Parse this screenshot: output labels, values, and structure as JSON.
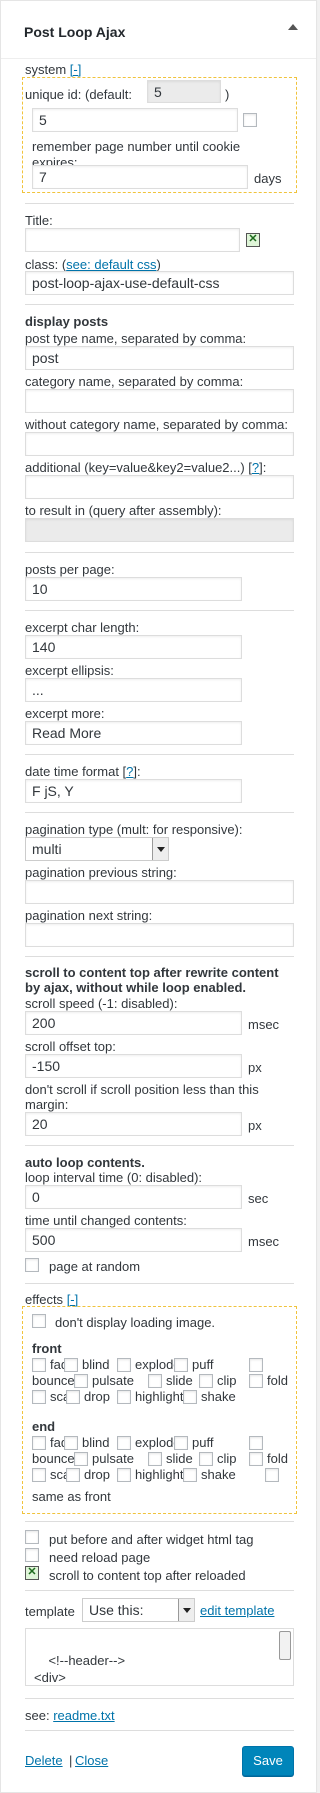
{
  "widget": {
    "title": "Post Loop Ajax"
  },
  "system": {
    "label": "system",
    "toggle": "[-]",
    "unique_id_prefix": "unique id: (default:",
    "unique_id_default": "5",
    "unique_id_suffix": ")",
    "unique_id_value": "5",
    "remember_line1": "remember page number until cookie",
    "remember_line2": "expires:",
    "days_value": "7",
    "days_unit": "days"
  },
  "title_field": {
    "label": "Title:",
    "value": ""
  },
  "class_field": {
    "prefix": "class: (",
    "link": "see: default css",
    "suffix": ")",
    "value": "post-loop-ajax-use-default-css"
  },
  "display_posts": {
    "heading": "display posts",
    "post_type_label": "post type name, separated by comma:",
    "post_type_value": "post",
    "category_label": "category name, separated by comma:",
    "category_value": "",
    "without_category_label": "without category name, separated by comma:",
    "without_category_value": "",
    "additional_label": "additional (key=value&key2=value2...) [",
    "additional_help": "?",
    "additional_suffix": "]:",
    "additional_value": "",
    "result_label": "to result in (query after assembly):",
    "result_value": ""
  },
  "posts_per_page": {
    "label": "posts per page:",
    "value": "10"
  },
  "excerpt": {
    "char_length_label": "excerpt char length:",
    "char_length_value": "140",
    "ellipsis_label": "excerpt ellipsis:",
    "ellipsis_value": "...",
    "more_label": "excerpt more:",
    "more_value": "Read More"
  },
  "date_time": {
    "label_prefix": "date time format [",
    "help": "?",
    "label_suffix": "]:",
    "value": "F jS, Y"
  },
  "pagination": {
    "type_label": "pagination type (mult: for responsive):",
    "type_value": "multi",
    "prev_label": "pagination previous string:",
    "prev_value": "",
    "next_label": "pagination next string:",
    "next_value": ""
  },
  "scroll": {
    "heading_line1": "scroll to content top after rewrite content",
    "heading_line2": "by ajax, without while loop enabled.",
    "speed_label": "scroll speed (-1: disabled):",
    "speed_value": "200",
    "speed_unit": "msec",
    "offset_label": "scroll offset top:",
    "offset_value": "-150",
    "offset_unit": "px",
    "margin_label_line1": "don't scroll if scroll position less than this",
    "margin_label_line2": "margin:",
    "margin_value": "20",
    "margin_unit": "px"
  },
  "auto_loop": {
    "heading": "auto loop contents.",
    "interval_label": "loop interval time (0: disabled):",
    "interval_value": "0",
    "interval_unit": "sec",
    "changed_label": "time until changed contents:",
    "changed_value": "500",
    "changed_unit": "msec",
    "random_label": "page at random"
  },
  "effects": {
    "label": "effects",
    "toggle": "[-]",
    "no_loading_label": "don't display loading image.",
    "front_heading": "front",
    "end_heading": "end",
    "row1": [
      "fade",
      "blind",
      "explode",
      "puff"
    ],
    "row2": [
      "bounce",
      "pulsate",
      "slide",
      "clip",
      "fold"
    ],
    "row3": [
      "scale",
      "drop",
      "highlight",
      "shake"
    ],
    "same_as_front": "same as front"
  },
  "options": {
    "put_before_after": "put before and after widget html tag",
    "need_reload": "need reload page",
    "scroll_after_reload": "scroll to content top after reloaded"
  },
  "template": {
    "label": "template",
    "select_value": "Use this:",
    "edit_link": "edit template",
    "content": "<!--header-->\n<div>\n  <!-- <div style=\"overflow-y:auto;"
  },
  "see": {
    "prefix": "see: ",
    "link": "readme.txt"
  },
  "footer": {
    "delete": "Delete",
    "separator": "|",
    "close": "Close",
    "save": "Save"
  }
}
